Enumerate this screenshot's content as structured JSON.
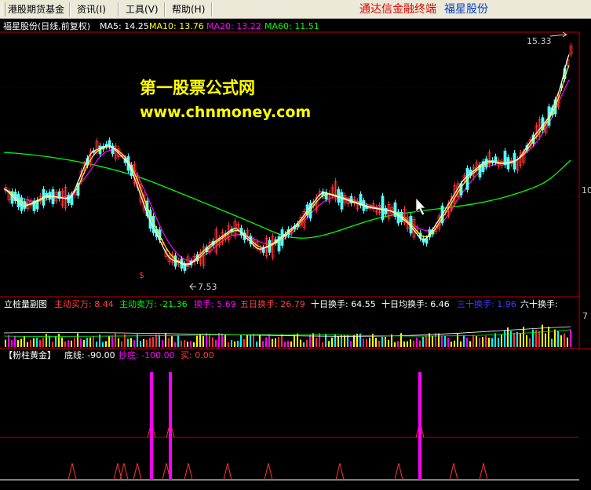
{
  "menubar": {
    "items": [
      {
        "label": "港股期货基金"
      },
      {
        "label": "资讯(I)"
      },
      {
        "label": "工具(V)"
      },
      {
        "label": "帮助(H)"
      }
    ],
    "brand_terminal": "通达信金融终端",
    "brand_stock": "福星股份"
  },
  "main_panel": {
    "title": "福星股份(日线,前复权)",
    "ma": [
      {
        "label": "MA5: 14.25",
        "color": "#ffffff"
      },
      {
        "label": "MA10: 13.76",
        "color": "#ffff00"
      },
      {
        "label": "MA20: 13.22",
        "color": "#ff00ff"
      },
      {
        "label": "MA60: 11.51",
        "color": "#00ff00"
      }
    ],
    "high_label": "15.33",
    "low_label": "7.53",
    "watermark_title": "第一股票公式网",
    "watermark_url": "www.chnmoney.com",
    "right_edge_label": "10",
    "bottom_marker": "$",
    "colors": {
      "up": "#ff3232",
      "down": "#54ffff",
      "ma5": "#ffffff",
      "ma10": "#ffff00",
      "ma20": "#ff00ff",
      "ma60": "#00ff00",
      "frame": "#c00000"
    }
  },
  "volume_panel": {
    "title": "立桩量副图",
    "items": [
      {
        "label": "主动买万: 8.44",
        "color": "#ff4040"
      },
      {
        "label": "主动卖万: -21.36",
        "color": "#00ff00"
      },
      {
        "label": "换手: 5.69",
        "color": "#ff00ff"
      },
      {
        "label": "五日换手: 26.79",
        "color": "#ff4040"
      },
      {
        "label": "十日换手: 64.55",
        "color": "#ffffff"
      },
      {
        "label": "十日均换手: 6.46",
        "color": "#ffffff"
      },
      {
        "label": "三十换手: 1.96",
        "color": "#4040ff"
      },
      {
        "label": "六十换手:",
        "color": "#ffffff"
      }
    ],
    "right_label": "7"
  },
  "indicator_panel": {
    "title": "【粉柱黄金】",
    "items": [
      {
        "label": "底线: -90.00",
        "color": "#ffffff"
      },
      {
        "label": "抄底: -100.00",
        "color": "#ff00ff"
      },
      {
        "label": "买: 0.00",
        "color": "#ff4040"
      }
    ]
  }
}
